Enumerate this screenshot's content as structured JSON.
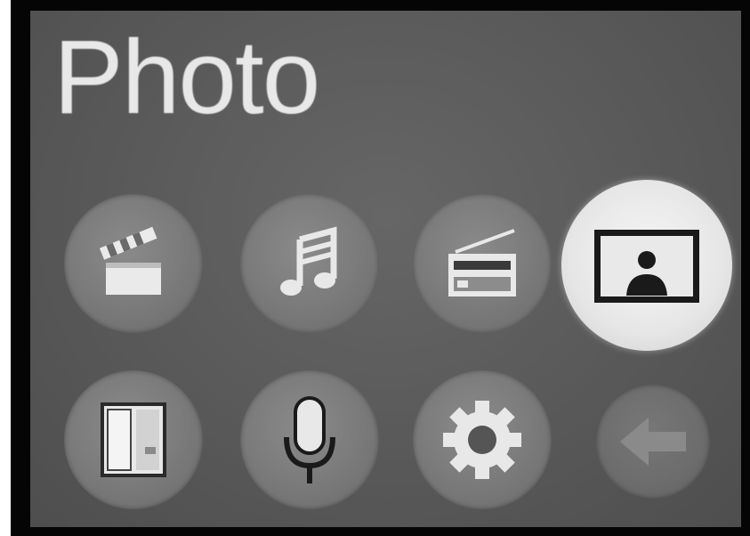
{
  "app": {
    "title": "Photo"
  },
  "menu": {
    "items": [
      {
        "id": "video",
        "icon": "clapperboard-icon",
        "selected": false
      },
      {
        "id": "music",
        "icon": "music-note-icon",
        "selected": false
      },
      {
        "id": "radio",
        "icon": "radio-icon",
        "selected": false
      },
      {
        "id": "photo",
        "icon": "photo-portrait-icon",
        "selected": true
      },
      {
        "id": "ebook",
        "icon": "book-icon",
        "selected": false
      },
      {
        "id": "recorder",
        "icon": "microphone-icon",
        "selected": false
      },
      {
        "id": "settings",
        "icon": "gear-icon",
        "selected": false
      },
      {
        "id": "back",
        "icon": "back-arrow-icon",
        "selected": false
      }
    ]
  },
  "colors": {
    "background": "#5a5a5a",
    "button": "#7b7b7b",
    "selected_button": "#e6e6e6",
    "icon_light": "#e8e8e8",
    "icon_dark": "#1a1a1a"
  }
}
